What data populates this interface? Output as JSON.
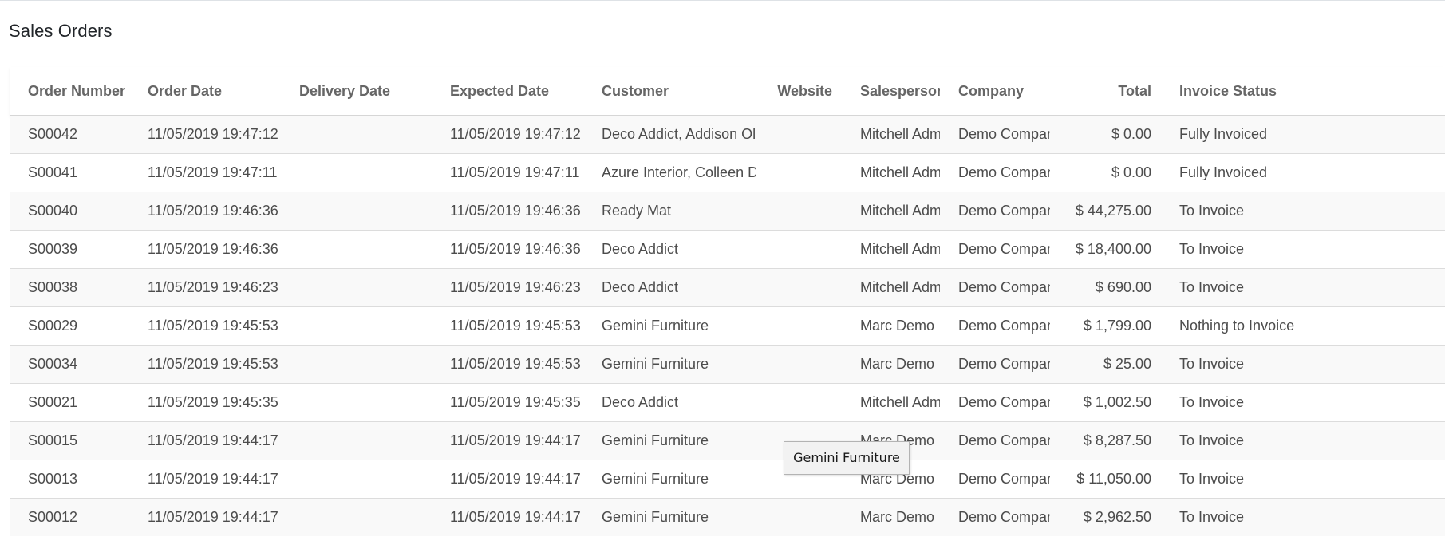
{
  "page": {
    "title": "Sales Orders"
  },
  "table": {
    "columns": [
      "Order Number",
      "Order Date",
      "Delivery Date",
      "Expected Date",
      "Customer",
      "Website",
      "Salesperson",
      "Company",
      "Total",
      "Invoice Status"
    ],
    "rows": [
      [
        "S00042",
        "11/05/2019 19:47:12",
        "",
        "11/05/2019 19:47:12",
        "Deco Addict, Addison Olson",
        "",
        "Mitchell Admin",
        "Demo Company",
        "$ 0.00",
        "Fully Invoiced"
      ],
      [
        "S00041",
        "11/05/2019 19:47:11",
        "",
        "11/05/2019 19:47:11",
        "Azure Interior, Colleen Diaz",
        "",
        "Mitchell Admin",
        "Demo Company",
        "$ 0.00",
        "Fully Invoiced"
      ],
      [
        "S00040",
        "11/05/2019 19:46:36",
        "",
        "11/05/2019 19:46:36",
        "Ready Mat",
        "",
        "Mitchell Admin",
        "Demo Company",
        "$ 44,275.00",
        "To Invoice"
      ],
      [
        "S00039",
        "11/05/2019 19:46:36",
        "",
        "11/05/2019 19:46:36",
        "Deco Addict",
        "",
        "Mitchell Admin",
        "Demo Company",
        "$ 18,400.00",
        "To Invoice"
      ],
      [
        "S00038",
        "11/05/2019 19:46:23",
        "",
        "11/05/2019 19:46:23",
        "Deco Addict",
        "",
        "Mitchell Admin",
        "Demo Company",
        "$ 690.00",
        "To Invoice"
      ],
      [
        "S00029",
        "11/05/2019 19:45:53",
        "",
        "11/05/2019 19:45:53",
        "Gemini Furniture",
        "",
        "Marc Demo",
        "Demo Company",
        "$ 1,799.00",
        "Nothing to Invoice"
      ],
      [
        "S00034",
        "11/05/2019 19:45:53",
        "",
        "11/05/2019 19:45:53",
        "Gemini Furniture",
        "",
        "Marc Demo",
        "Demo Company",
        "$ 25.00",
        "To Invoice"
      ],
      [
        "S00021",
        "11/05/2019 19:45:35",
        "",
        "11/05/2019 19:45:35",
        "Deco Addict",
        "",
        "Mitchell Admin",
        "Demo Company",
        "$ 1,002.50",
        "To Invoice"
      ],
      [
        "S00015",
        "11/05/2019 19:44:17",
        "",
        "11/05/2019 19:44:17",
        "Gemini Furniture",
        "",
        "Marc Demo",
        "Demo Company",
        "$ 8,287.50",
        "To Invoice"
      ],
      [
        "S00013",
        "11/05/2019 19:44:17",
        "",
        "11/05/2019 19:44:17",
        "Gemini Furniture",
        "",
        "Marc Demo",
        "Demo Company",
        "$ 11,050.00",
        "To Invoice"
      ],
      [
        "S00012",
        "11/05/2019 19:44:17",
        "",
        "11/05/2019 19:44:17",
        "Gemini Furniture",
        "",
        "Marc Demo",
        "Demo Company",
        "$ 2,962.50",
        "To Invoice"
      ]
    ]
  },
  "tooltip": {
    "text": "Gemini Furniture"
  }
}
